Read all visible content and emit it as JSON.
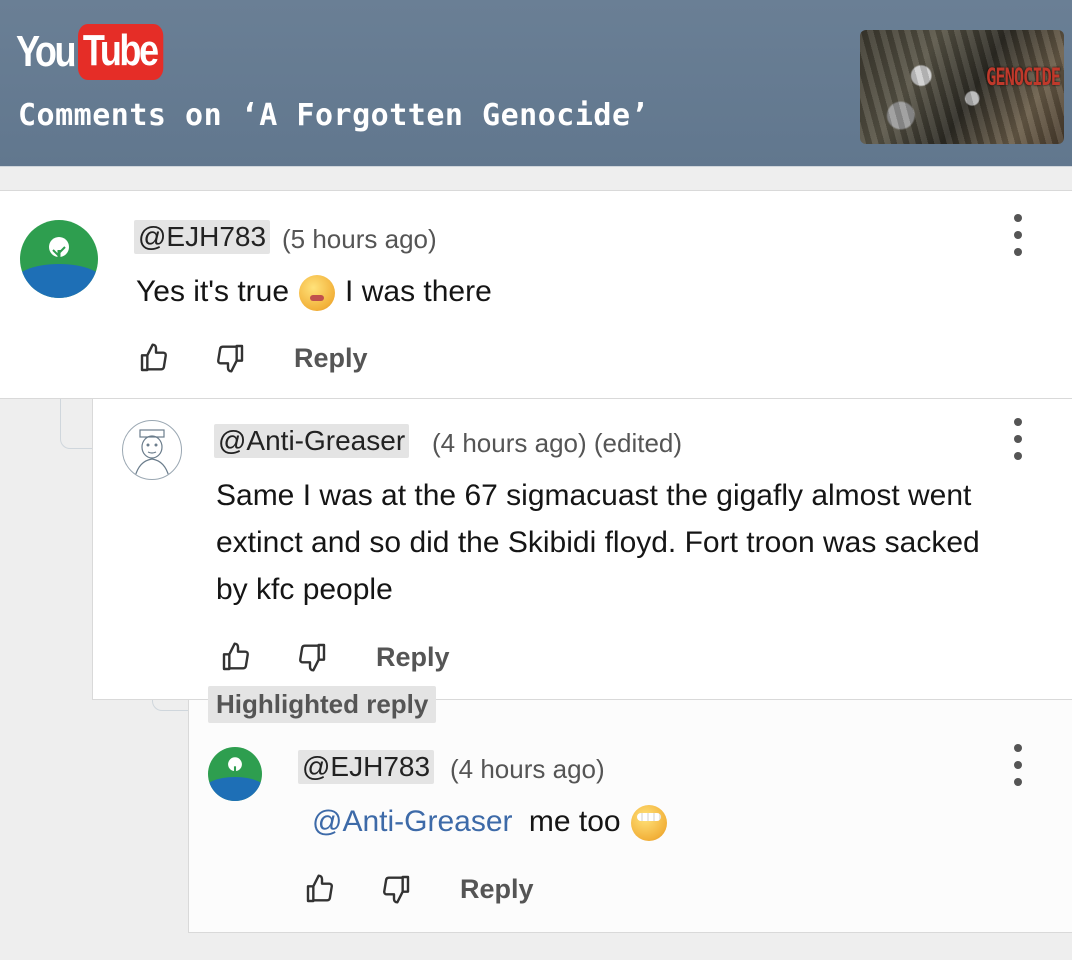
{
  "header": {
    "logo_you": "You",
    "logo_tube": "Tube",
    "title": "Comments on ‘A Forgotten Genocide’",
    "thumbnail_text": "GENOCIDE"
  },
  "comments": [
    {
      "author": "@EJH783",
      "time": "(5 hours ago)",
      "text_before": "Yes it's true",
      "emoji": "hot-face-emoji",
      "text_after": "I was there",
      "reply_label": "Reply"
    },
    {
      "author": "@Anti-Greaser",
      "time": "(4 hours ago) (edited)",
      "lines": [
        "Same I was at the 67 sigmacuast the gigafly almost went",
        "extinct and so did the Skibidi floyd. Fort troon was sacked",
        "by kfc people"
      ],
      "reply_label": "Reply"
    },
    {
      "badge": "Highlighted reply",
      "author": "@EJH783",
      "time": "(4 hours ago)",
      "mention": "@Anti-Greaser",
      "text_after": "me too",
      "emoji": "head-bandage-emoji",
      "reply_label": "Reply"
    }
  ],
  "colors": {
    "header_bg": "#61778e",
    "youtube_red": "#e52d27",
    "mention_blue": "#3d6aa8"
  }
}
